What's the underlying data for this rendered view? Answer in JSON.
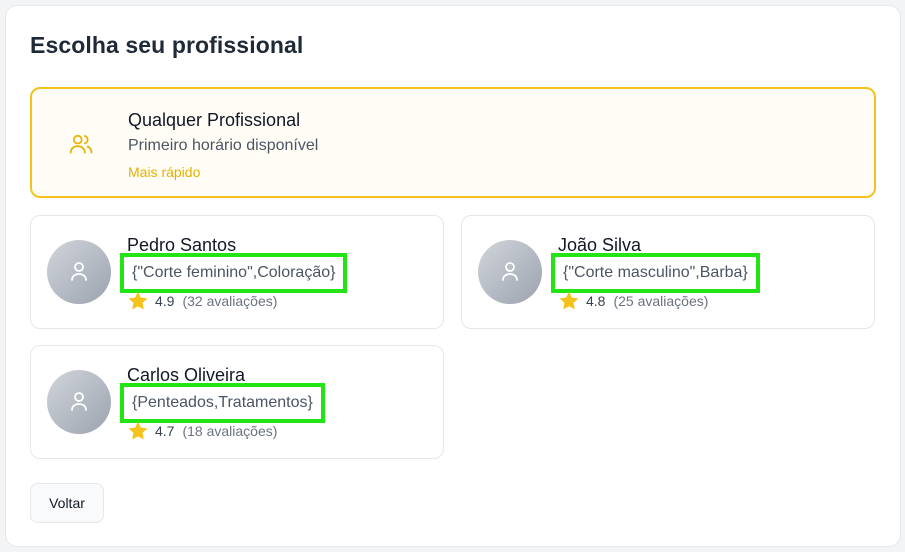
{
  "page": {
    "title": "Escolha seu profissional"
  },
  "any_professional": {
    "name": "Qualquer Profissional",
    "subtitle": "Primeiro horário disponível",
    "badge": "Mais rápido",
    "icon": "users-icon",
    "accent_color": "#f5c21b"
  },
  "professionals": [
    {
      "name": "Pedro Santos",
      "specialties": "{\"Corte feminino\",Coloração}",
      "rating": "4.9",
      "reviews": "(32 avaliações)"
    },
    {
      "name": "João Silva",
      "specialties": "{\"Corte masculino\",Barba}",
      "rating": "4.8",
      "reviews": "(25 avaliações)"
    },
    {
      "name": "Carlos Oliveira",
      "specialties": "{Penteados,Tratamentos}",
      "rating": "4.7",
      "reviews": "(18 avaliações)"
    }
  ],
  "icons": {
    "avatar": "user-icon",
    "rating": "star-icon"
  },
  "colors": {
    "star": "#f5c21b",
    "highlight_box": "#22e514"
  },
  "actions": {
    "back_label": "Voltar"
  }
}
